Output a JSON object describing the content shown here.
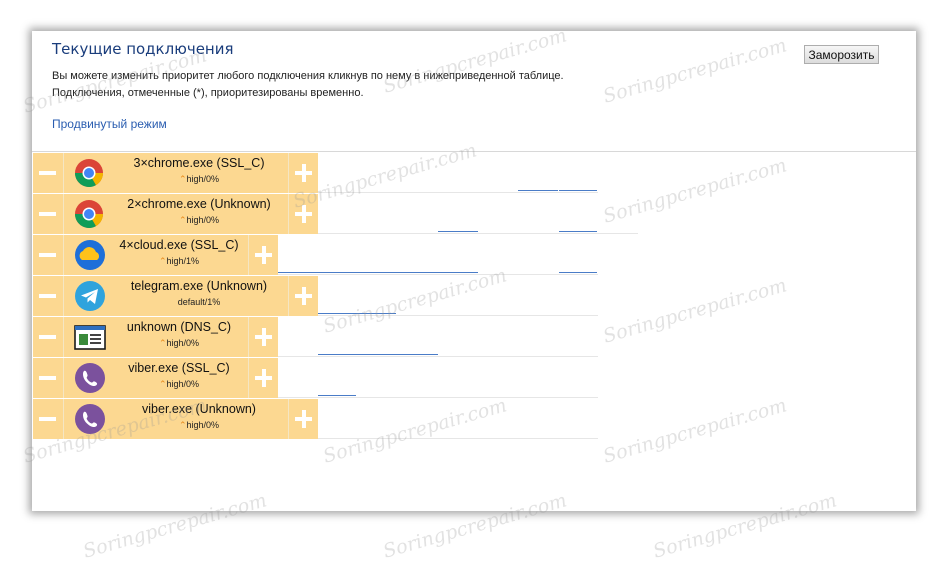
{
  "header": {
    "title": "Текущие подключения",
    "desc_line1": "Вы можете изменить приоритет любого подключения кликнув по нему в нижеприведенной таблице.",
    "desc_line2": "Подключения, отмеченные (*), приоритезированы временно.",
    "advanced_link": "Продвинутый режим",
    "freeze_button": "Заморозить"
  },
  "connections": [
    {
      "name": "3×chrome.exe (SSL_C)",
      "priority": "high/0%",
      "icon": "chrome-icon",
      "chevron": true
    },
    {
      "name": "2×chrome.exe (Unknown)",
      "priority": "high/0%",
      "icon": "chrome-icon",
      "chevron": true
    },
    {
      "name": "4×cloud.exe (SSL_C)",
      "priority": "high/1%",
      "icon": "cloud-icon",
      "chevron": true
    },
    {
      "name": "telegram.exe (Unknown)",
      "priority": "default/1%",
      "icon": "telegram-icon",
      "chevron": false
    },
    {
      "name": "unknown (DNS_C)",
      "priority": "high/0%",
      "icon": "window-app-icon",
      "chevron": true
    },
    {
      "name": "viber.exe (SSL_C)",
      "priority": "high/0%",
      "icon": "viber-icon",
      "chevron": true
    },
    {
      "name": "viber.exe (Unknown)",
      "priority": "high/0%",
      "icon": "viber-icon",
      "chevron": true
    }
  ],
  "watermark": "Soringpcrepair.com",
  "colors": {
    "row_bg": "#fcd891",
    "title": "#1a3d7c",
    "link": "#2a5db0",
    "priority_chevron": "#e88a1a",
    "bandwidth_line": "#4a7cc7"
  }
}
